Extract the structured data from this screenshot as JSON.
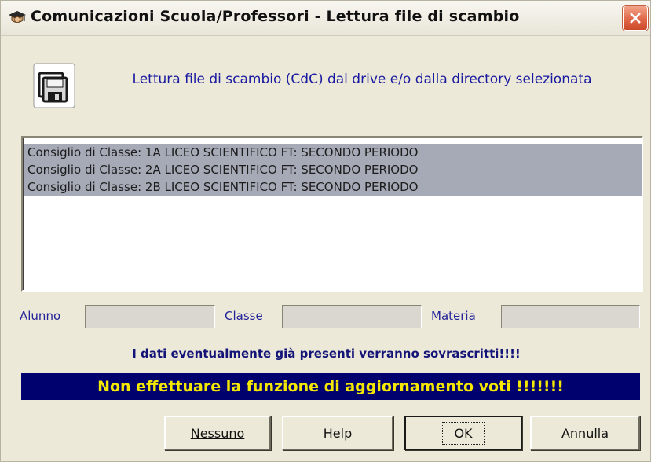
{
  "window": {
    "title": "Comunicazioni  Scuola/Professori - Lettura file di scambio"
  },
  "header": {
    "text": "Lettura file di scambio (CdC) dal drive e/o dalla directory selezionata"
  },
  "list": {
    "items": [
      "Consiglio di Classe: 1A LICEO SCIENTIFICO FT: SECONDO PERIODO",
      "Consiglio di Classe: 2A LICEO SCIENTIFICO FT: SECONDO PERIODO",
      "Consiglio di Classe: 2B LICEO SCIENTIFICO FT: SECONDO PERIODO"
    ]
  },
  "fields": {
    "alunno": {
      "label": "Alunno",
      "value": ""
    },
    "classe": {
      "label": "Classe",
      "value": ""
    },
    "materia": {
      "label": "Materia",
      "value": ""
    }
  },
  "warnings": {
    "overwrite": "I dati eventualmente già presenti verranno sovrascritti!!!!",
    "no_update": "Non effettuare la funzione di aggiornamento voti !!!!!!!"
  },
  "buttons": {
    "nessuno": "Nessuno",
    "help": "Help",
    "ok": "OK",
    "annulla": "Annulla"
  },
  "icons": {
    "title": "graduate-icon",
    "close": "close-icon",
    "header": "floppy-disk-icon"
  },
  "colors": {
    "window_bg": "#ece9d8",
    "header_text": "#1a1aa0",
    "list_selection": "#a6aab6",
    "banner_bg": "#00006e",
    "banner_text": "#f5e800",
    "close_button": "#e06848"
  }
}
